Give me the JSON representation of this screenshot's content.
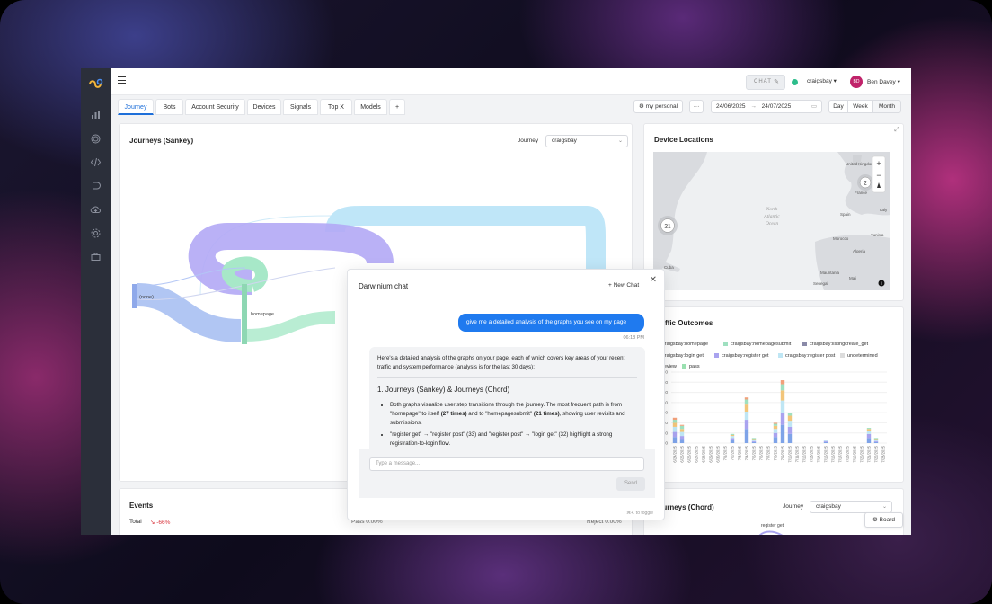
{
  "topbar": {
    "chat_label": "CHAT",
    "site": "craigsbay",
    "avatar_initials": "BD",
    "user": "Ben Davey"
  },
  "tabs": [
    "Journey",
    "Bots",
    "Account Security",
    "Devices",
    "Signals",
    "Top X",
    "Models"
  ],
  "add_tab": "+",
  "filters": {
    "profile": "my personal",
    "more": "···",
    "date_from": "24/06/2025",
    "arrow": "→",
    "date_to": "24/07/2025",
    "ranges": [
      "Day",
      "Week",
      "Month"
    ]
  },
  "sankey": {
    "title": "Journeys (Sankey)",
    "filter_label": "Journey",
    "filter_value": "craigsbay",
    "nodes": [
      "(none)",
      "homepage"
    ]
  },
  "events": {
    "title": "Events",
    "total_label": "Total",
    "total_change": "-66%",
    "pass_label": "Pass",
    "pass_value": "0.00%",
    "reject_label": "Reject",
    "reject_value": "0.00%"
  },
  "device_locations": {
    "title": "Device Locations",
    "labels": [
      "North",
      "Atlantic",
      "Ocean",
      "United Kingdom",
      "France",
      "Spain",
      "Italy",
      "Morocco",
      "Algeria",
      "Tunisia",
      "Mali",
      "Mauritania",
      "Senegal",
      "Cuba"
    ],
    "clusters": [
      {
        "count": "21"
      },
      {
        "count": "2"
      }
    ],
    "zoom_in": "+",
    "zoom_out": "−"
  },
  "traffic": {
    "title": "Traffic Outcomes",
    "legend": [
      {
        "label": "craigsbay:homepage",
        "color": "#7ea3e8"
      },
      {
        "label": "craigsbay:homepagesubmit",
        "color": "#9fe0c0"
      },
      {
        "label": "craigsbay:listingcreate_get",
        "color": "#8a8aa8"
      },
      {
        "label": "craigsbay:login get",
        "color": "#f2c57a"
      },
      {
        "label": "craigsbay:register get",
        "color": "#a9a3ef"
      },
      {
        "label": "craigsbay:register post",
        "color": "#bfe6f4"
      },
      {
        "label": "undetermined",
        "color": "#dcdcdc"
      },
      {
        "label": "review",
        "color": "#f2a07a"
      },
      {
        "label": "pass",
        "color": "#9ae0b0"
      }
    ]
  },
  "chord": {
    "title": "Journeys (Chord)",
    "filter_label": "Journey",
    "filter_value": "craigsbay",
    "node": "register get",
    "board_label": "Board"
  },
  "chat": {
    "title": "Darwinium chat",
    "new_chat": "New Chat",
    "user_message": "give me a detailed analysis of the graphs you see on my page",
    "time": "06:18 PM",
    "bot_intro": "Here's a detailed analysis of the graphs on your page, each of which covers key areas of your recent traffic and system performance (analysis is for the last 30 days):",
    "bot_heading": "1. Journeys (Sankey) & Journeys (Chord)",
    "bot_b1_pre": "Both graphs visualize user step transitions through the journey. The most frequent path is from \"homepage\" to itself ",
    "bot_b1_b1": "(27 times)",
    "bot_b1_mid": " and to \"homepagesubmit\" ",
    "bot_b1_b2": "(21 times)",
    "bot_b1_post": ", showing user revisits and submissions.",
    "bot_b2": "\"register get\" → \"register post\" (33) and \"register post\" → \"login get\" (32) highlight a strong registration-to-login flow.",
    "placeholder": "Type a message...",
    "send": "Send",
    "hint": "⌘+. to toggle"
  },
  "chart_data": {
    "type": "bar",
    "title": "Traffic Outcomes",
    "ylim": [
      0,
      70
    ],
    "yticks": [
      "70",
      "60",
      "50",
      "40",
      "30",
      "20",
      "10",
      "0"
    ],
    "categories": [
      "6/24/2025",
      "6/25/2025",
      "6/26/2025",
      "6/27/2025",
      "6/28/2025",
      "6/29/2025",
      "6/30/2025",
      "7/1/2025",
      "7/2/2025",
      "7/3/2025",
      "7/4/2025",
      "7/5/2025",
      "7/6/2025",
      "7/7/2025",
      "7/8/2025",
      "7/9/2025",
      "7/10/2025",
      "7/11/2025",
      "7/12/2025",
      "7/13/2025",
      "7/14/2025",
      "7/15/2025",
      "7/16/2025",
      "7/17/2025",
      "7/18/2025",
      "7/19/2025",
      "7/20/2025",
      "7/21/2025",
      "7/22/2025",
      "7/23/2025"
    ],
    "series": [
      {
        "name": "craigsbay:homepage",
        "color": "#7ea3e8",
        "values": [
          6,
          4,
          0,
          0,
          0,
          0,
          0,
          0,
          3,
          0,
          14,
          1,
          0,
          0,
          6,
          18,
          9,
          0,
          0,
          0,
          0,
          1,
          0,
          0,
          0,
          0,
          0,
          5,
          1,
          0
        ]
      },
      {
        "name": "craigsbay:register get",
        "color": "#a9a3ef",
        "values": [
          5,
          3,
          0,
          0,
          0,
          0,
          0,
          0,
          2,
          0,
          9,
          1,
          0,
          0,
          4,
          12,
          7,
          0,
          0,
          0,
          0,
          1,
          0,
          0,
          0,
          0,
          0,
          4,
          1,
          0
        ]
      },
      {
        "name": "craigsbay:register post",
        "color": "#bfe6f4",
        "values": [
          5,
          4,
          0,
          0,
          0,
          0,
          0,
          0,
          2,
          0,
          8,
          1,
          0,
          0,
          4,
          12,
          6,
          0,
          0,
          0,
          0,
          1,
          0,
          0,
          0,
          0,
          0,
          3,
          1,
          0
        ]
      },
      {
        "name": "craigsbay:login get",
        "color": "#f2c57a",
        "values": [
          4,
          3,
          0,
          0,
          0,
          0,
          0,
          0,
          1,
          0,
          7,
          1,
          0,
          0,
          3,
          10,
          5,
          0,
          0,
          0,
          0,
          0,
          0,
          0,
          0,
          0,
          0,
          2,
          1,
          0
        ]
      },
      {
        "name": "craigsbay:homepagesubmit",
        "color": "#9fe0c0",
        "values": [
          3,
          3,
          0,
          0,
          0,
          0,
          0,
          0,
          1,
          0,
          5,
          1,
          0,
          0,
          2,
          6,
          3,
          0,
          0,
          0,
          0,
          0,
          0,
          0,
          0,
          0,
          0,
          1,
          1,
          0
        ]
      },
      {
        "name": "review",
        "color": "#f2a07a",
        "values": [
          2,
          1,
          0,
          0,
          0,
          0,
          0,
          0,
          0,
          0,
          2,
          0,
          0,
          0,
          1,
          4,
          0,
          0,
          0,
          0,
          0,
          0,
          0,
          0,
          0,
          0,
          0,
          0,
          0,
          0
        ]
      }
    ]
  }
}
